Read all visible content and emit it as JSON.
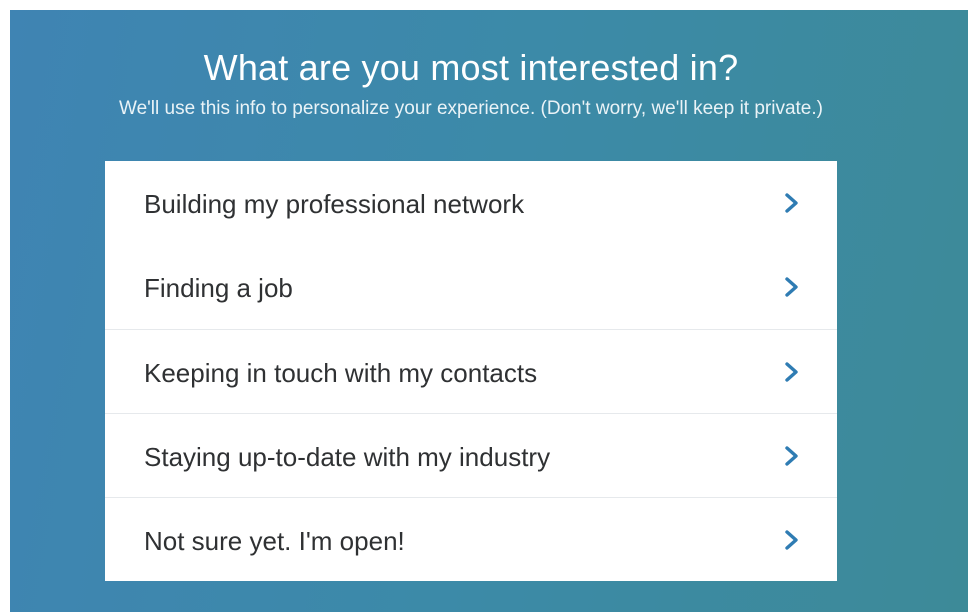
{
  "header": {
    "title": "What are you most interested in?",
    "subtitle": "We'll use this info to personalize your experience. (Don't worry, we'll keep it private.)"
  },
  "options": [
    {
      "label": "Building my professional network",
      "icon": "chevron-right-icon"
    },
    {
      "label": "Finding a job",
      "icon": "chevron-right-icon"
    },
    {
      "label": "Keeping in touch with my contacts",
      "icon": "chevron-right-icon"
    },
    {
      "label": "Staying up-to-date with my industry",
      "icon": "chevron-right-icon"
    },
    {
      "label": "Not sure yet. I'm open!",
      "icon": "chevron-right-icon"
    }
  ],
  "colors": {
    "background_start": "#3f84b3",
    "background_end": "#3d8a98",
    "chevron": "#2f7cb3",
    "option_text": "#2f3133",
    "card": "#ffffff"
  }
}
